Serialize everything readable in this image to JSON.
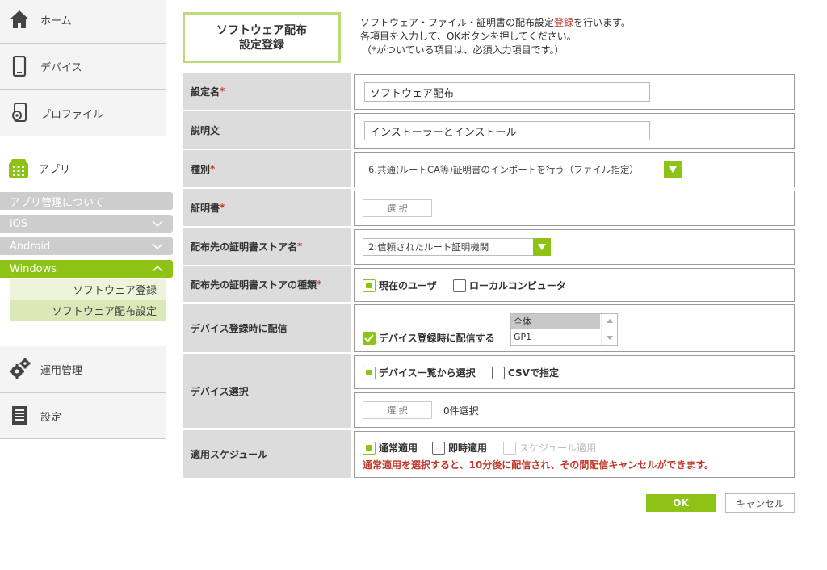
{
  "sidebar": {
    "home_label": "ホーム",
    "device_label": "デバイス",
    "profile_label": "プロファイル",
    "app_label": "アプリ",
    "app_items": [
      {
        "label": "アプリ管理について"
      },
      {
        "label": "iOS"
      },
      {
        "label": "Android"
      },
      {
        "label": "Windows"
      }
    ],
    "windows_items": [
      {
        "label": "ソフトウェア登録"
      },
      {
        "label": "ソフトウェア配布設定"
      }
    ],
    "ops_label": "運用管理",
    "settings_label": "設定"
  },
  "header": {
    "title_line1": "ソフトウェア配布",
    "title_line2": "設定登録",
    "desc_line1_pre": "ソフトウェア・ファイル・証明書の配布設定",
    "desc_line1_red": "登録",
    "desc_line1_post": "を行います。",
    "desc_line2": "各項目を入力して、OKボタンを押してください。",
    "desc_line3": "（*がついている項目は、必須入力項目です。）"
  },
  "form": {
    "setting_name": {
      "label": "設定名",
      "value": "ソフトウェア配布"
    },
    "description": {
      "label": "説明文",
      "value": "インストーラーとインストール"
    },
    "type": {
      "label": "種別",
      "value": "6.共通(ルートCA等)証明書のインポートを行う（ファイル指定）"
    },
    "certificate": {
      "label": "証明書",
      "button": "選 択"
    },
    "store_name": {
      "label": "配布先の証明書ストア名",
      "value": "2:信頼されたルート証明機関"
    },
    "store_type": {
      "label": "配布先の証明書ストアの種類",
      "opt1": "現在のユーザ",
      "opt2": "ローカルコンピュータ"
    },
    "deliver_on_register": {
      "label": "デバイス登録時に配信",
      "checkbox": "デバイス登録時に配信する",
      "list": [
        "全体",
        "GP1"
      ]
    },
    "device_select": {
      "label": "デバイス選択",
      "opt1": "デバイス一覧から選択",
      "opt2": "CSVで指定",
      "button": "選 択",
      "count": "0件選択"
    },
    "schedule": {
      "label": "適用スケジュール",
      "opt1": "通常適用",
      "opt2": "即時適用",
      "opt3": "スケジュール適用",
      "note": "通常適用を選択すると、10分後に配信され、その間配信キャンセルができます。"
    },
    "required_mark": "*"
  },
  "actions": {
    "ok": "OK",
    "cancel": "キャンセル"
  },
  "colors": {
    "accent": "#8cc314",
    "required": "#c0392b",
    "label_bg": "#dcdcdc"
  }
}
